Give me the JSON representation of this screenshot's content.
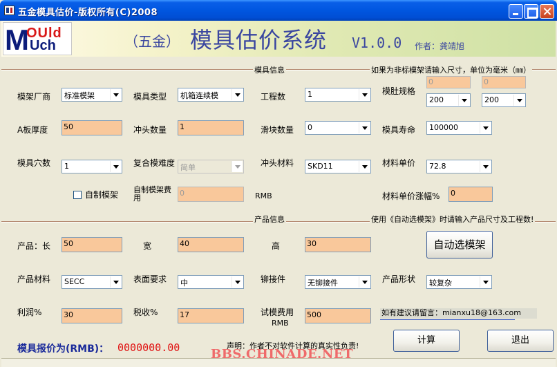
{
  "window": {
    "title": "五金模具估价-版权所有(C)2008"
  },
  "banner": {
    "logo_m": "M",
    "logo_ould": "OUld",
    "logo_uch": "Uch",
    "subtitle": "（五金）",
    "title": "模具估价系统",
    "version": "V1.0.0",
    "author": "作者：龚靖旭"
  },
  "mold_section": {
    "label": "模具信息",
    "hint": "如果为非标模架请输入尺寸，单位为毫米（㎜）",
    "frame_vendor": {
      "label": "模架厂商",
      "value": "标准模架"
    },
    "mold_type": {
      "label": "模具类型",
      "value": "机箱连续模"
    },
    "stations": {
      "label": "工程数",
      "value": "1"
    },
    "cavity_spec": {
      "label": "模肚规格",
      "w_input": "0",
      "h_input": "0",
      "w_select": "200",
      "h_select": "200"
    },
    "a_plate": {
      "label": "A板厚度",
      "value": "50"
    },
    "punch_count": {
      "label": "冲头数量",
      "value": "1"
    },
    "slider_count": {
      "label": "滑块数量",
      "value": "0"
    },
    "mold_life": {
      "label": "模具寿命",
      "value": "100000"
    },
    "cavities": {
      "label": "模具穴数",
      "value": "1"
    },
    "compound_diff": {
      "label": "复合模难度",
      "value": "简单"
    },
    "punch_material": {
      "label": "冲头材料",
      "value": "SKD11"
    },
    "material_price": {
      "label": "材料单价",
      "value": "72.8"
    },
    "self_made": {
      "label": "自制模架"
    },
    "self_cost": {
      "label": "自制模架费用",
      "value": "0",
      "unit": "RMB"
    },
    "price_rise": {
      "label": "材料单价涨幅%",
      "value": "0"
    }
  },
  "product_section": {
    "label": "产品信息",
    "hint": "使用《自动选模架》时请输入产品尺寸及工程数!",
    "length": {
      "label": "产品：长",
      "value": "50"
    },
    "width": {
      "label": "宽",
      "value": "40"
    },
    "height": {
      "label": "高",
      "value": "30"
    },
    "auto_button": "自动选模架",
    "material": {
      "label": "产品材料",
      "value": "SECC"
    },
    "surface": {
      "label": "表面要求",
      "value": "中"
    },
    "rivet": {
      "label": "铆接件",
      "value": "无铆接件"
    },
    "shape": {
      "label": "产品形状",
      "value": "较复杂"
    },
    "profit": {
      "label": "利润%",
      "value": "30"
    },
    "tax": {
      "label": "税收%",
      "value": "17"
    },
    "trial_fee": {
      "label": "试模费用",
      "unit": "RMB",
      "value": "500"
    },
    "contact": "如有建议请留言：mianxu18@163.com"
  },
  "footer": {
    "price_label": "模具报价为(RMB)：",
    "price_value": "0000000.00",
    "notice": "声明：作者不对软件计算的真实性负责!",
    "calc_button": "计算",
    "exit_button": "退出",
    "watermark": "BBS.CHINADE.NET"
  }
}
